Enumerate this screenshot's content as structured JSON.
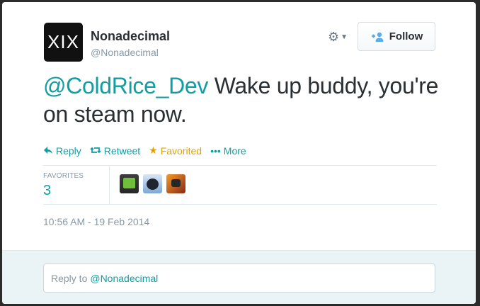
{
  "user": {
    "avatar_text": "XIX",
    "name": "Nonadecimal",
    "handle": "@Nonadecimal"
  },
  "follow_button": {
    "label": "Follow",
    "icon": "person-plus-icon"
  },
  "settings_icon": "gear-icon",
  "tweet": {
    "mention": "@ColdRice_Dev",
    "text": " Wake up buddy, you're on steam now."
  },
  "actions": [
    {
      "icon": "reply-icon",
      "label": "Reply"
    },
    {
      "icon": "retweet-icon",
      "label": "Retweet"
    },
    {
      "icon": "star-icon",
      "label": "Favorited"
    },
    {
      "icon": "more-dots-icon",
      "label": "More"
    }
  ],
  "stats": {
    "favorites_label": "FAVORITES",
    "favorites_count": "3"
  },
  "timestamp": "10:56 AM - 19 Feb 2014",
  "reply": {
    "prefix": "Reply to",
    "mention": "@Nonadecimal"
  },
  "colors": {
    "link": "#0f9ea3",
    "favorited": "#e0a300",
    "follow_icon": "#55acee"
  }
}
